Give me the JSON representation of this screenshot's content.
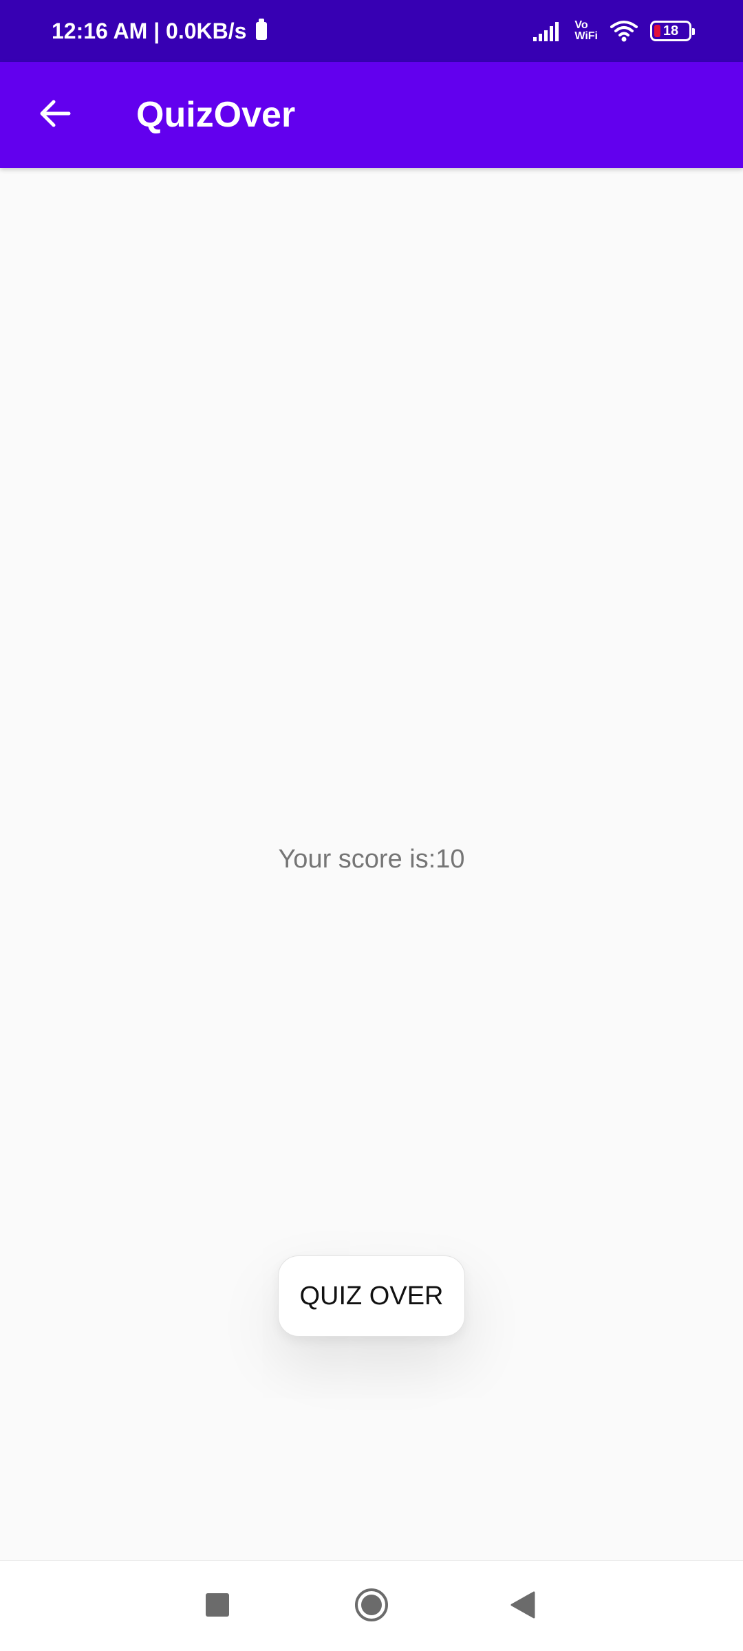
{
  "status_bar": {
    "time_speed": "12:16 AM | 0.0KB/s",
    "vowifi_top": "Vo",
    "vowifi_bottom": "WiFi",
    "battery_level": "18",
    "battery_fraction": 0.18,
    "battery_color": "#e0103a"
  },
  "app_bar": {
    "title": "QuizOver",
    "back_icon": "arrow-left-icon",
    "color": "#6200ee",
    "status_color": "#3700b3"
  },
  "content": {
    "score_text": "Your score is:10"
  },
  "toast": {
    "text": "QUIZ OVER"
  },
  "nav_bar": {
    "recents_icon": "square-icon",
    "home_icon": "circle-icon",
    "back_icon": "triangle-back-icon"
  }
}
